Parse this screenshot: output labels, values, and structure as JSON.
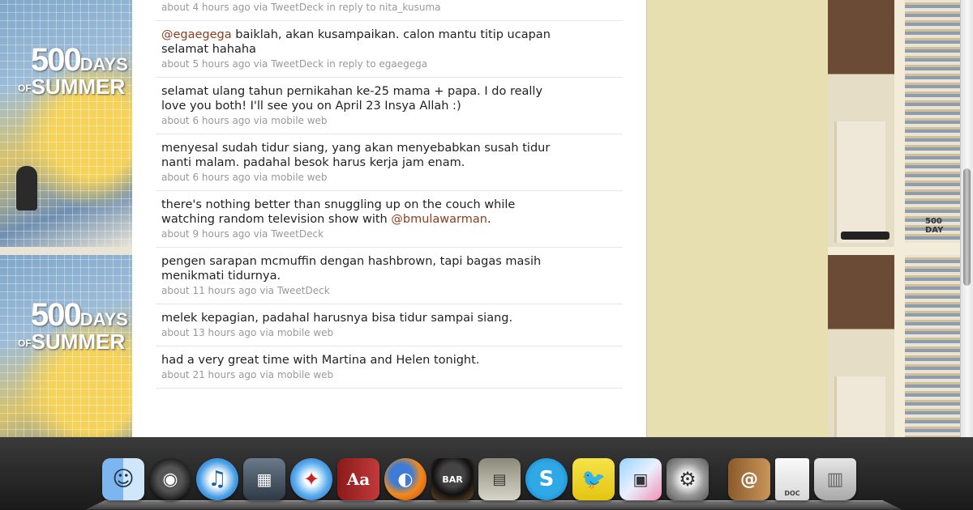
{
  "wallpaper": {
    "poster_title_number": "500",
    "poster_title_days": "DAYS",
    "poster_title_of": "OF",
    "poster_title_summer": "SUMMER",
    "poster_small_text": "500 DAY"
  },
  "tweets": [
    {
      "segments": [],
      "text": "",
      "meta": {
        "time": "about 4 hours ago",
        "via_label": "via",
        "source": "TweetDeck",
        "reply_prefix": "in reply to",
        "reply_to": "nita_kusuma"
      }
    },
    {
      "mention": "@egaegega",
      "text": " baiklah, akan kusampaikan. calon mantu titip ucapan selamat hahaha",
      "meta": {
        "time": "about 5 hours ago",
        "via_label": "via",
        "source": "TweetDeck",
        "reply_prefix": "in reply to",
        "reply_to": "egaegega"
      }
    },
    {
      "text": "selamat ulang tahun pernikahan ke-25 mama + papa. I do really love you both! I'll see you on April 23 Insya Allah :)",
      "meta": {
        "time": "about 6 hours ago",
        "via_label": "via",
        "source": "mobile web"
      }
    },
    {
      "text": "menyesal sudah tidur siang, yang akan menyebabkan susah tidur nanti malam. padahal besok harus kerja jam enam.",
      "meta": {
        "time": "about 6 hours ago",
        "via_label": "via",
        "source": "mobile web"
      }
    },
    {
      "text_before": "there's nothing better than snuggling up on the couch while watching random television show with ",
      "mention": "@bmulawarman",
      "text_after": ".",
      "meta": {
        "time": "about 9 hours ago",
        "via_label": "via",
        "source": "TweetDeck"
      }
    },
    {
      "text": "pengen sarapan mcmuffin dengan hashbrown, tapi bagas masih menikmati tidurnya.",
      "meta": {
        "time": "about 11 hours ago",
        "via_label": "via",
        "source": "TweetDeck"
      }
    },
    {
      "text": "melek kepagian, padahal harusnya bisa tidur sampai siang.",
      "meta": {
        "time": "about 13 hours ago",
        "via_label": "via",
        "source": "mobile web"
      }
    },
    {
      "text": "had a very great time with Martina and Helen tonight.",
      "meta": {
        "time": "about 21 hours ago",
        "via_label": "via",
        "source": "mobile web"
      }
    }
  ],
  "dock": {
    "items": [
      {
        "name": "finder",
        "glyph": "☺"
      },
      {
        "name": "dashboard",
        "glyph": "◉"
      },
      {
        "name": "itunes",
        "glyph": "♫"
      },
      {
        "name": "expose",
        "glyph": "▦"
      },
      {
        "name": "safari",
        "glyph": "✦"
      },
      {
        "name": "dictionary",
        "glyph": "Aa"
      },
      {
        "name": "firefox",
        "glyph": "◐"
      },
      {
        "name": "bomb",
        "glyph": "BAR"
      },
      {
        "name": "toolbar",
        "glyph": "▤"
      },
      {
        "name": "skype",
        "glyph": "S"
      },
      {
        "name": "twitterrific",
        "glyph": "🐦"
      },
      {
        "name": "preview",
        "glyph": "▣"
      },
      {
        "name": "system-preferences",
        "glyph": "⚙"
      },
      {
        "name": "address-book",
        "glyph": "@"
      },
      {
        "name": "doc",
        "glyph": "DOC"
      },
      {
        "name": "trash",
        "glyph": "▥"
      }
    ]
  },
  "colors": {
    "mention": "#8f3b1c",
    "sidebar": "#e8dfb0",
    "meta": "#999999"
  }
}
